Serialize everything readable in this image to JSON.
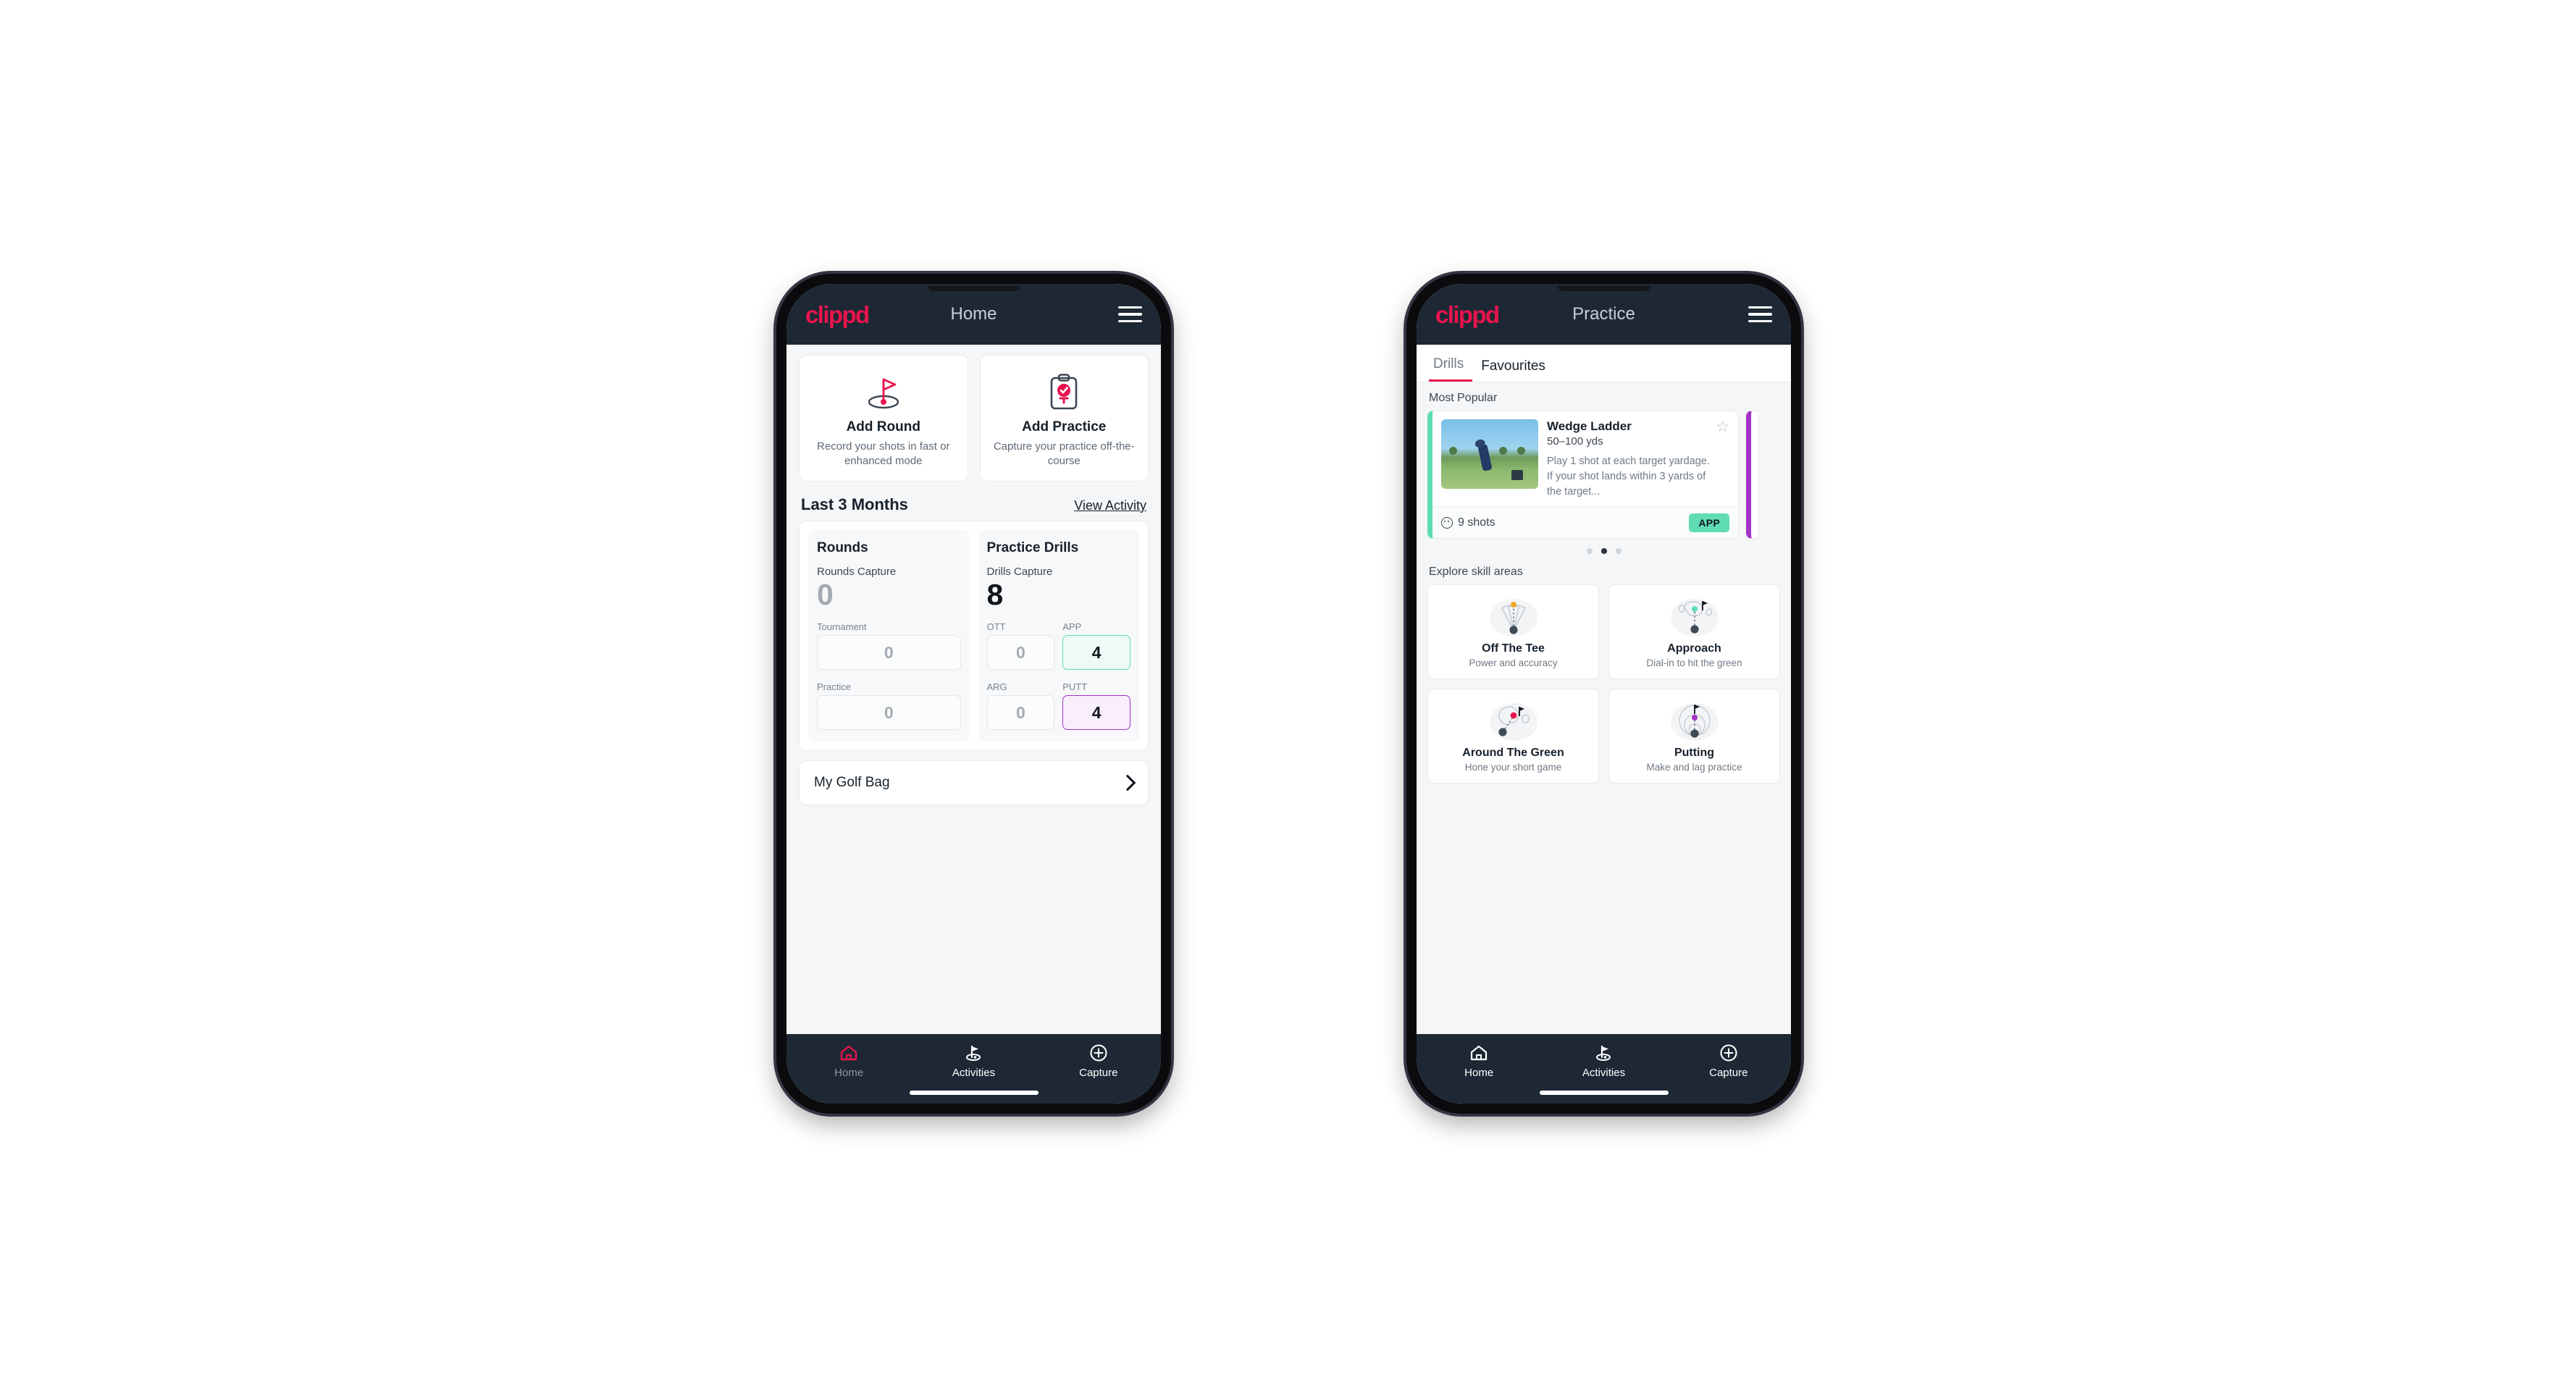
{
  "brand": {
    "logo": "clippd",
    "accent": "#e8144e",
    "mint": "#5fdcb4",
    "violet": "#a432c8",
    "navy": "#1d2834"
  },
  "phone_home": {
    "appbar": {
      "logo": "clippd",
      "title": "Home",
      "menu_icon": "hamburger-menu-icon"
    },
    "actions": [
      {
        "icon": "golf-flag-icon",
        "title": "Add Round",
        "subtitle": "Record your shots in fast or enhanced mode"
      },
      {
        "icon": "clipboard-check-icon",
        "title": "Add Practice",
        "subtitle": "Capture your practice off-the-course"
      }
    ],
    "section": {
      "title": "Last 3 Months",
      "link": "View Activity"
    },
    "rounds": {
      "title": "Rounds",
      "capture_label": "Rounds Capture",
      "capture_value": "0",
      "fields": [
        {
          "label": "Tournament",
          "value": "0",
          "highlight": "none"
        },
        {
          "label": "Practice",
          "value": "0",
          "highlight": "none"
        }
      ]
    },
    "drills": {
      "title": "Practice Drills",
      "capture_label": "Drills Capture",
      "capture_value": "8",
      "fields": [
        {
          "label": "OTT",
          "value": "0",
          "highlight": "none"
        },
        {
          "label": "APP",
          "value": "4",
          "highlight": "mint"
        },
        {
          "label": "ARG",
          "value": "0",
          "highlight": "none"
        },
        {
          "label": "PUTT",
          "value": "4",
          "highlight": "violet"
        }
      ]
    },
    "golf_bag": {
      "label": "My Golf Bag",
      "icon": "chevron-right-icon"
    },
    "nav": [
      {
        "label": "Home",
        "icon": "home-icon",
        "active": true
      },
      {
        "label": "Activities",
        "icon": "golf-flag-icon",
        "active": false
      },
      {
        "label": "Capture",
        "icon": "plus-circle-icon",
        "active": false
      }
    ]
  },
  "phone_practice": {
    "appbar": {
      "logo": "clippd",
      "title": "Practice",
      "menu_icon": "hamburger-menu-icon"
    },
    "tabs": [
      {
        "label": "Drills",
        "active": true
      },
      {
        "label": "Favourites",
        "active": false
      }
    ],
    "most_popular_label": "Most Popular",
    "drill": {
      "name": "Wedge Ladder",
      "range": "50–100 yds",
      "description": "Play 1 shot at each target yardage. If your shot lands within 3 yards of the target...",
      "shots": "9 shots",
      "badge": "APP",
      "favourite_icon": "star-outline-icon",
      "accent": "#5fdcb4"
    },
    "carousel_dots": {
      "count": 3,
      "active_index": 1
    },
    "skill_label": "Explore skill areas",
    "skills": [
      {
        "name": "Off The Tee",
        "subtitle": "Power and accuracy",
        "icon": "tee-shot-cone-icon",
        "dot": "#f0a82a"
      },
      {
        "name": "Approach",
        "subtitle": "Dial-in to hit the green",
        "icon": "approach-green-icon",
        "dot": "#5fdcb4"
      },
      {
        "name": "Around The Green",
        "subtitle": "Hone your short game",
        "icon": "chip-green-icon",
        "dot": "#e8144e"
      },
      {
        "name": "Putting",
        "subtitle": "Make and lag practice",
        "icon": "putting-rings-icon",
        "dot": "#a432c8"
      }
    ],
    "nav": [
      {
        "label": "Home",
        "icon": "home-icon",
        "active": false
      },
      {
        "label": "Activities",
        "icon": "golf-flag-icon",
        "active": true
      },
      {
        "label": "Capture",
        "icon": "plus-circle-icon",
        "active": false
      }
    ]
  }
}
